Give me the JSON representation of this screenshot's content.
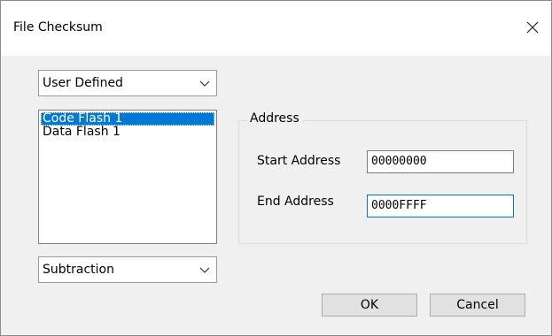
{
  "window": {
    "title": "File Checksum",
    "close_glyph": "close-icon"
  },
  "area_combo": {
    "selected": "User Defined",
    "arrow_icon": "chevron-down-icon"
  },
  "area_list": {
    "items": [
      {
        "label": "Code Flash 1",
        "selected": true
      },
      {
        "label": "Data Flash 1",
        "selected": false
      }
    ]
  },
  "method_combo": {
    "selected": "Subtraction",
    "arrow_icon": "chevron-down-icon"
  },
  "address_group": {
    "legend": "Address",
    "start_label": "Start Address",
    "start_value": "00000000",
    "end_label": "End Address",
    "end_value": "0000FFFF"
  },
  "buttons": {
    "ok_label": "OK",
    "cancel_label": "Cancel"
  },
  "colors": {
    "selection": "#0078d7",
    "dialog_bg": "#f0f0f0",
    "button_bg": "#e1e1e1"
  }
}
